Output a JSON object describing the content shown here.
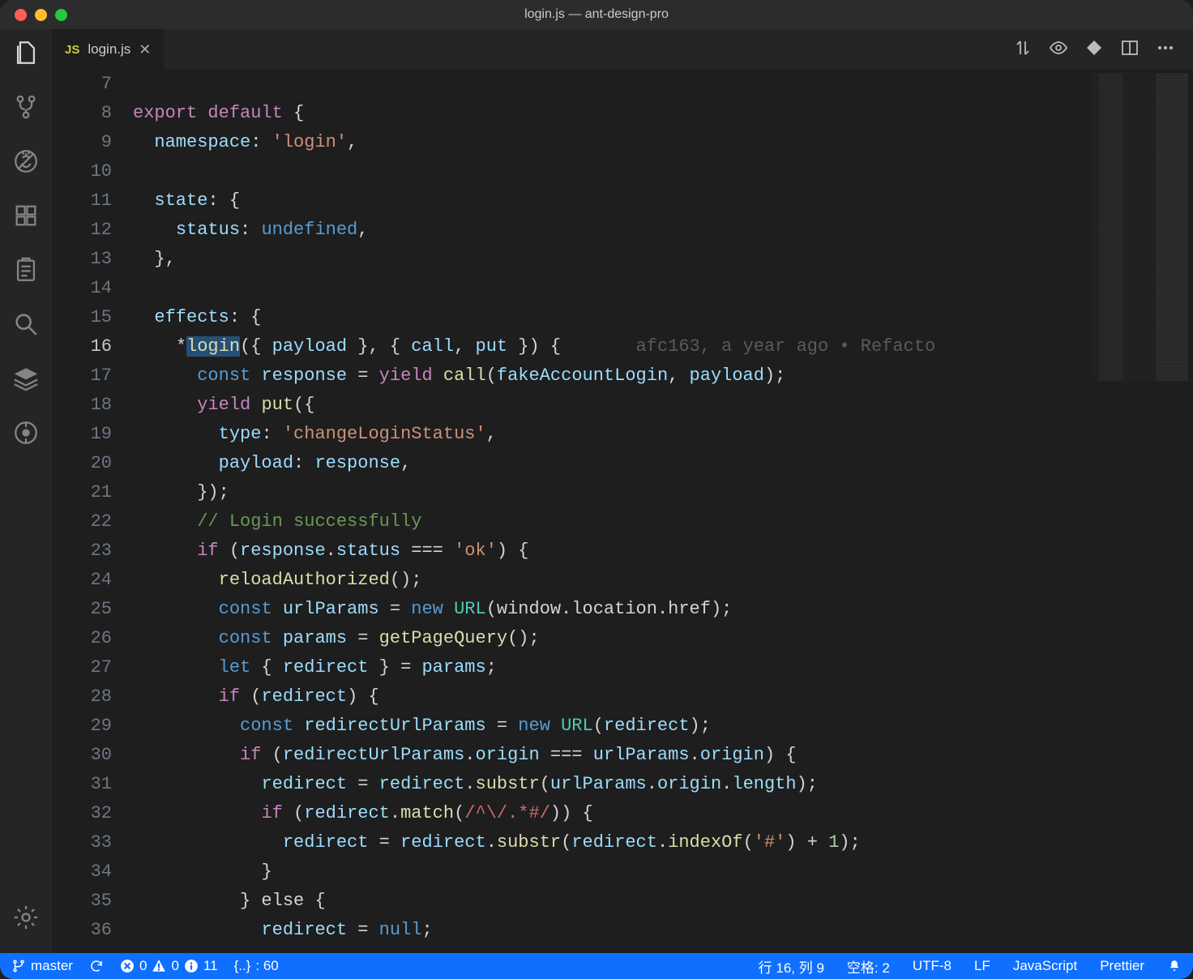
{
  "window": {
    "title": "login.js — ant-design-pro"
  },
  "tab": {
    "file_icon": "JS",
    "label": "login.js"
  },
  "blame": "afc163, a year ago • Refacto",
  "lines": {
    "n7": "7",
    "n8": "8",
    "n9": "9",
    "n10": "10",
    "n11": "11",
    "n12": "12",
    "n13": "13",
    "n14": "14",
    "n15": "15",
    "n16": "16",
    "n17": "17",
    "n18": "18",
    "n19": "19",
    "n20": "20",
    "n21": "21",
    "n22": "22",
    "n23": "23",
    "n24": "24",
    "n25": "25",
    "n26": "26",
    "n27": "27",
    "n28": "28",
    "n29": "29",
    "n30": "30",
    "n31": "31",
    "n32": "32",
    "n33": "33",
    "n34": "34",
    "n35": "35",
    "n36": "36"
  },
  "code": {
    "l8_kw": "export",
    "l8_kw2": "default",
    "l8_rest": " {",
    "l9_k": "namespace",
    "l9_v": "'login'",
    "l11_k": "state",
    "l12_k": "status",
    "l12_v": "undefined",
    "l15_k": "effects",
    "l16_star": "*",
    "l16_fn": "login",
    "l16_args_p1": "({ ",
    "l16_arg1": "payload",
    "l16_args_p2": " }, { ",
    "l16_arg2": "call",
    "l16_args_p3": ", ",
    "l16_arg3": "put",
    "l16_args_p4": " }) {",
    "l17_kw": "const",
    "l17_var": "response",
    "l17_eq": " = ",
    "l17_kw2": "yield",
    "l17_sp": " ",
    "l17_fn": "call",
    "l17_args_open": "(",
    "l17_a1": "fakeAccountLogin",
    "l17_comma": ", ",
    "l17_a2": "payload",
    "l17_args_close": ");",
    "l18_kw": "yield",
    "l18_fn": "put",
    "l18_open": "({",
    "l19_k": "type",
    "l19_v": "'changeLoginStatus'",
    "l20_k": "payload",
    "l20_v": "response",
    "l21_close": "});",
    "l22_cmt": "// Login successfully",
    "l23_if": "if",
    "l23_open": " (",
    "l23_obj": "response",
    "l23_dot": ".",
    "l23_prop": "status",
    "l23_eq": " === ",
    "l23_str": "'ok'",
    "l23_close": ") {",
    "l24_fn": "reloadAuthorized",
    "l24_call": "();",
    "l25_kw": "const",
    "l25_var": "urlParams",
    "l25_eq": " = ",
    "l25_new": "new",
    "l25_sp": " ",
    "l25_cls": "URL",
    "l25_args": "(window.location.href);",
    "l26_kw": "const",
    "l26_var": "params",
    "l26_eq": " = ",
    "l26_fn": "getPageQuery",
    "l26_call": "();",
    "l27_kw": "let",
    "l27_open": " { ",
    "l27_var": "redirect",
    "l27_close": " } = ",
    "l27_src": "params",
    "l27_semi": ";",
    "l28_if": "if",
    "l28_open": " (",
    "l28_var": "redirect",
    "l28_close": ") {",
    "l29_kw": "const",
    "l29_var": "redirectUrlParams",
    "l29_eq": " = ",
    "l29_new": "new",
    "l29_sp": " ",
    "l29_cls": "URL",
    "l29_args_open": "(",
    "l29_arg": "redirect",
    "l29_args_close": ");",
    "l30_if": "if",
    "l30_open": " (",
    "l30_a": "redirectUrlParams",
    "l30_dot": ".",
    "l30_p": "origin",
    "l30_eq": " === ",
    "l30_b": "urlParams",
    "l30_dot2": ".",
    "l30_p2": "origin",
    "l30_close": ") {",
    "l31_var": "redirect",
    "l31_eq": " = ",
    "l31_obj": "redirect",
    "l31_dot": ".",
    "l31_fn": "substr",
    "l31_args_open": "(",
    "l31_a": "urlParams",
    "l31_dot2": ".",
    "l31_p": "origin",
    "l31_dot3": ".",
    "l31_p2": "length",
    "l31_args_close": ");",
    "l32_if": "if",
    "l32_open": " (",
    "l32_obj": "redirect",
    "l32_dot": ".",
    "l32_fn": "match",
    "l32_args_open": "(",
    "l32_re": "/^\\/.*#/",
    "l32_args_close": ")) {",
    "l33_var": "redirect",
    "l33_eq": " = ",
    "l33_obj": "redirect",
    "l33_dot": ".",
    "l33_fn": "substr",
    "l33_args_open": "(",
    "l33_a": "redirect",
    "l33_dot2": ".",
    "l33_fn2": "indexOf",
    "l33_args2_open": "(",
    "l33_str": "'#'",
    "l33_args2_close": ") + ",
    "l33_num": "1",
    "l33_args_close": ");",
    "l34_close": "}",
    "l35_else": "} else {",
    "l36_var": "redirect",
    "l36_eq": " = ",
    "l36_null": "null",
    "l36_semi": ";"
  },
  "status": {
    "branch": "master",
    "errors": "0",
    "warnings": "0",
    "info": "11",
    "bracket_label": "{..}",
    "bracket_count": ": 60",
    "cursor": "行 16,  列 9",
    "spaces": "空格: 2",
    "encoding": "UTF-8",
    "eol": "LF",
    "language": "JavaScript",
    "formatter": "Prettier"
  }
}
